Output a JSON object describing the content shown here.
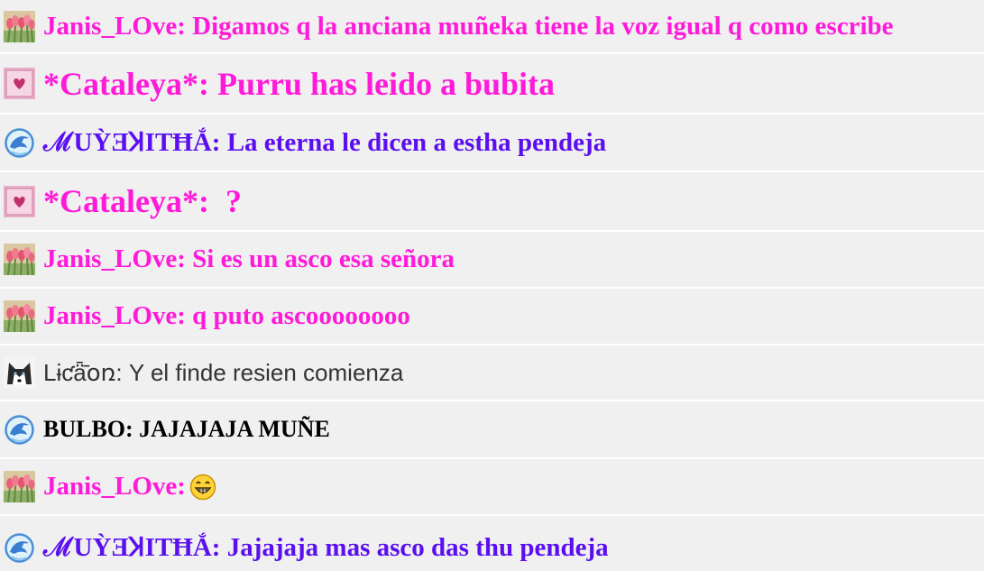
{
  "messages": [
    {
      "avatar": "tulips-avatar",
      "text": "Janis_LOve: Digamos q la anciana muñeka tiene la voz igual q como escribe",
      "color": "#ff1ad9"
    },
    {
      "avatar": "heart-card-avatar",
      "text": "*Cataleya*: Purru has leido a bubita",
      "color": "#ff1ad9"
    },
    {
      "avatar": "dolphin-avatar",
      "text": "ℳUỲƎꞰITĦẮ: La eterna le dicen a estha pendeja",
      "color": "#5b0ff0"
    },
    {
      "avatar": "heart-card-avatar",
      "text": "*Cataleya*:  ?",
      "color": "#ff1ad9"
    },
    {
      "avatar": "tulips-avatar",
      "text": "Janis_LOve: Si es un asco esa señora",
      "color": "#ff1ad9"
    },
    {
      "avatar": "tulips-avatar",
      "text": "Janis_LOve: q puto ascoooooooo",
      "color": "#ff1ad9"
    },
    {
      "avatar": "husky-avatar",
      "text": "Lɨƈǟ̄օռ: Y el finde resien comienza",
      "color": "#333333"
    },
    {
      "avatar": "dolphin-avatar",
      "text": "BULBO: JAJAJAJA MUÑE",
      "color": "#000000"
    },
    {
      "avatar": "tulips-avatar",
      "text": "Janis_LOve:",
      "emoji": "grin-emoji",
      "color": "#ff1ad9"
    },
    {
      "avatar": "dolphin-avatar",
      "text": "ℳUỲƎꞰITĦẮ: Jajajaja mas asco das thu pendeja",
      "color": "#5b0ff0"
    }
  ]
}
